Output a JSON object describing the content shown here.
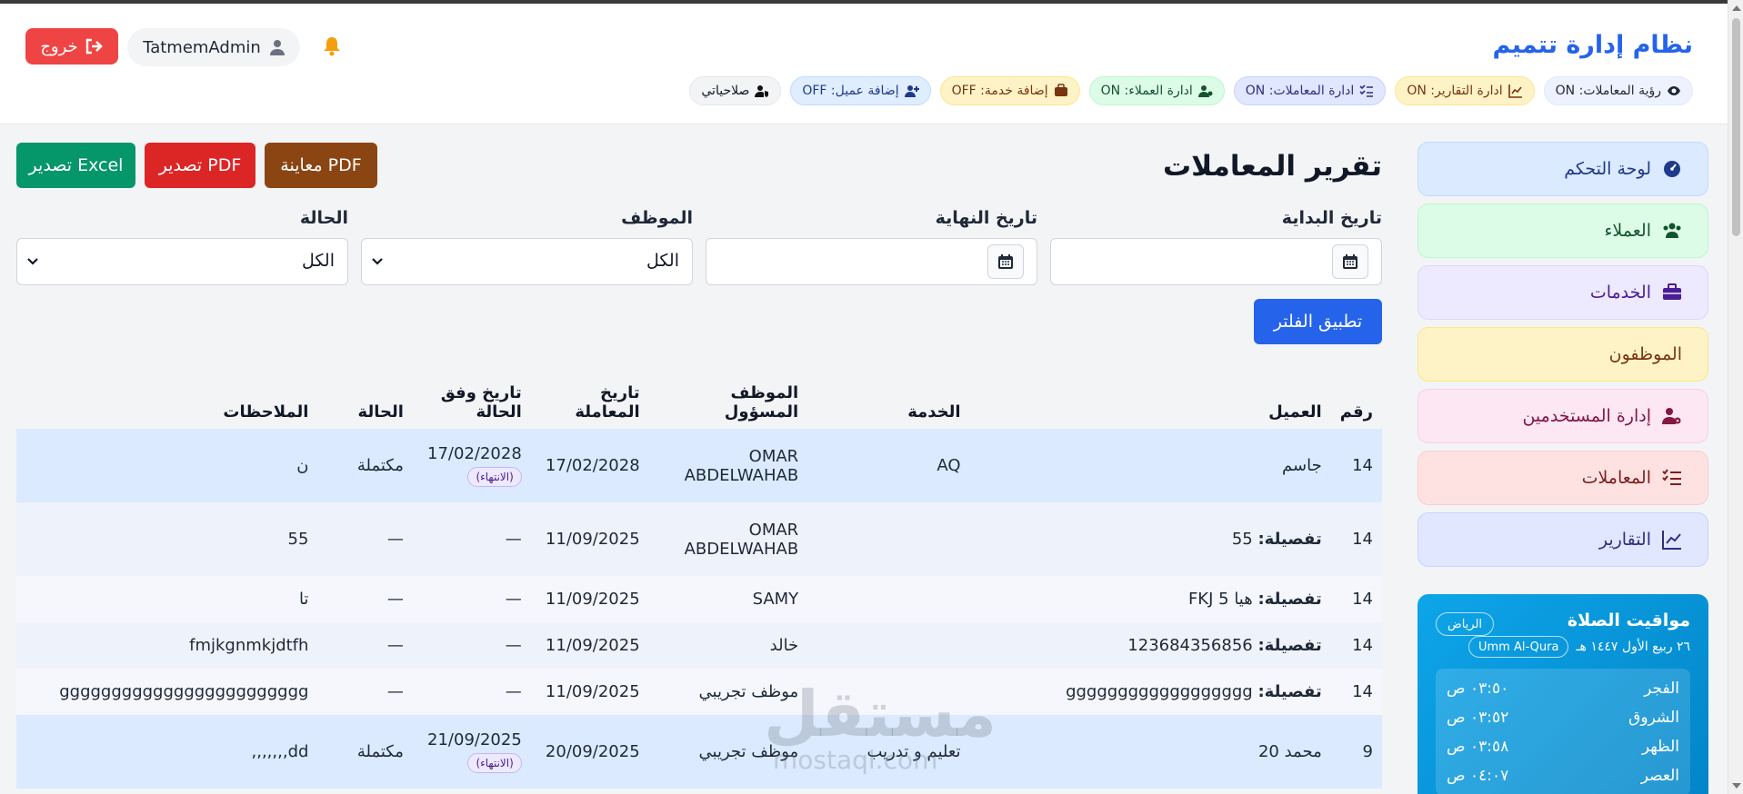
{
  "header": {
    "app_title": "نظام إدارة تتميم",
    "logout_label": "خروج",
    "username": "TatmemAdmin",
    "permissions": [
      {
        "label": "صلاحياتي",
        "icon": "user-shield-icon",
        "style": "gray"
      },
      {
        "label": "إضافة عميل: OFF",
        "icon": "user-plus-icon",
        "style": "blue"
      },
      {
        "label": "إضافة خدمة: OFF",
        "icon": "briefcase-icon",
        "style": "yellow"
      },
      {
        "label": "ادارة العملاء: ON",
        "icon": "users-cog-icon",
        "style": "green"
      },
      {
        "label": "ادارة المعاملات: ON",
        "icon": "list-check-icon",
        "style": "indigo"
      },
      {
        "label": "ادارة التقارير: ON",
        "icon": "chart-line-icon",
        "style": "yellow"
      },
      {
        "label": "رؤية المعاملات: ON",
        "icon": "eye-icon",
        "style": "slate"
      }
    ]
  },
  "sidebar": {
    "items": [
      {
        "label": "لوحة التحكم",
        "icon": "dashboard-icon",
        "style": "blue"
      },
      {
        "label": "العملاء",
        "icon": "users-icon",
        "style": "green"
      },
      {
        "label": "الخدمات",
        "icon": "briefcase-icon",
        "style": "purple"
      },
      {
        "label": "الموظفون",
        "icon": "",
        "style": "yellow"
      },
      {
        "label": "إدارة المستخدمين",
        "icon": "user-cog-icon",
        "style": "pink"
      },
      {
        "label": "المعاملات",
        "icon": "list-check-icon",
        "style": "red"
      },
      {
        "label": "التقارير",
        "icon": "chart-line-icon",
        "style": "indigo"
      }
    ]
  },
  "prayer": {
    "title": "مواقيت الصلاة",
    "city": "الرياض",
    "hijri_date": "٢٦ ربيع الأول ١٤٤٧ هـ",
    "calendar": "Umm Al-Qura",
    "times": [
      {
        "name": "الفجر",
        "time": "٠٣:٥٠ ص"
      },
      {
        "name": "الشروق",
        "time": "٠٣:٥٢ ص"
      },
      {
        "name": "الظهر",
        "time": "٠٣:٥٨ ص"
      },
      {
        "name": "العصر",
        "time": "٠٤:٠٧ ص"
      }
    ]
  },
  "main": {
    "title": "تقرير المعاملات",
    "preview_pdf": "معاينة PDF",
    "export_pdf": "تصدير PDF",
    "export_excel": "تصدير Excel",
    "filters": {
      "start_date_label": "تاريخ البداية",
      "end_date_label": "تاريخ النهاية",
      "employee_label": "الموظف",
      "employee_value": "الكل",
      "status_label": "الحالة",
      "status_value": "الكل"
    },
    "apply_filter": "تطبيق الفلتر"
  },
  "table": {
    "headers": [
      "رقم",
      "العميل",
      "الخدمة",
      "الموظف المسؤول",
      "تاريخ المعاملة",
      "تاريخ وفق الحالة",
      "الحالة",
      "الملاحظات"
    ],
    "rows": [
      {
        "num": "14",
        "client_prefix": "",
        "client": "جاسم",
        "service": "AQ",
        "employee": "OMAR ABDELWAHAB",
        "date": "17/02/2028",
        "status_date": "17/02/2028",
        "badge": "(الانتهاء)",
        "status": "مكتملة",
        "notes": "ن"
      },
      {
        "num": "14",
        "client_prefix": "تفصيلة:",
        "client": "55",
        "service": "",
        "employee": "OMAR ABDELWAHAB",
        "date": "11/09/2025",
        "status_date": "—",
        "badge": "",
        "status": "—",
        "notes": "55"
      },
      {
        "num": "14",
        "client_prefix": "تفصيلة:",
        "client": "هيا 5 FKJ",
        "service": "",
        "employee": "SAMY",
        "date": "11/09/2025",
        "status_date": "—",
        "badge": "",
        "status": "—",
        "notes": "تا"
      },
      {
        "num": "14",
        "client_prefix": "تفصيلة:",
        "client": "123684356856",
        "service": "",
        "employee": "خالد",
        "date": "11/09/2025",
        "status_date": "—",
        "badge": "",
        "status": "—",
        "notes": "fmjkgnmkjdtfh"
      },
      {
        "num": "14",
        "client_prefix": "تفصيلة:",
        "client": "gggggggggggggggggg",
        "service": "",
        "employee": "موظف تجريبي",
        "date": "11/09/2025",
        "status_date": "—",
        "badge": "",
        "status": "—",
        "notes": "gggggggggggggggggggggggg"
      },
      {
        "num": "9",
        "client_prefix": "",
        "client": "محمد 20",
        "service": "تعليم و تدريب",
        "employee": "موظف تجريبي",
        "date": "20/09/2025",
        "status_date": "21/09/2025",
        "badge": "(الانتهاء)",
        "status": "مكتملة",
        "notes": "dd,,,,,,,"
      }
    ]
  },
  "watermark": {
    "text": "مستقل",
    "sub": "mostaql.com"
  }
}
